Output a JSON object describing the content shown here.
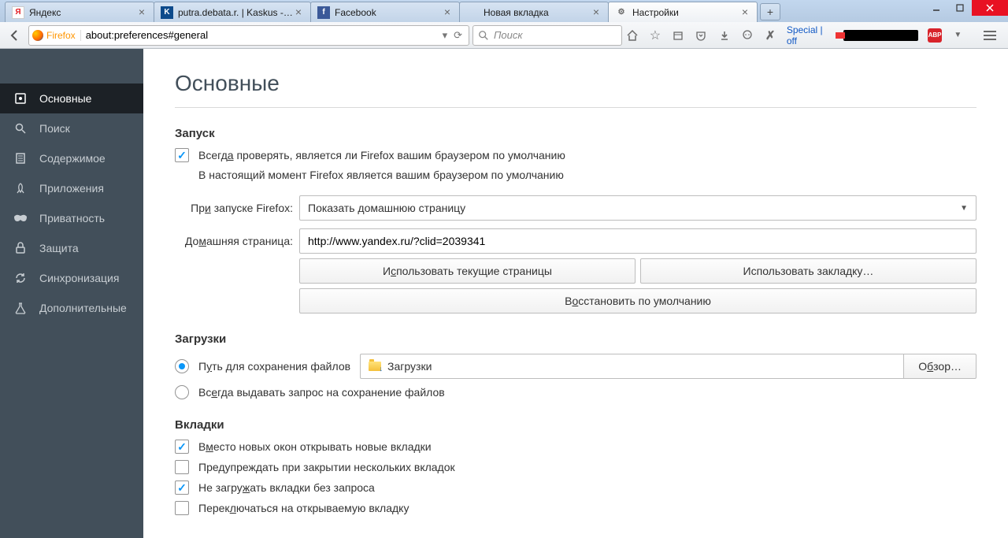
{
  "tabs": [
    {
      "label": "Яндекс"
    },
    {
      "label": "putra.debata.r. | Kaskus - ..."
    },
    {
      "label": "Facebook"
    },
    {
      "label": "Новая вкладка"
    },
    {
      "label": "Настройки"
    }
  ],
  "url": "about:preferences#general",
  "fx_label": "Firefox",
  "search_placeholder": "Поиск",
  "special_text": "Special | off",
  "abp": "ABP",
  "sidebar": [
    {
      "label": "Основные"
    },
    {
      "label": "Поиск"
    },
    {
      "label": "Содержимое"
    },
    {
      "label": "Приложения"
    },
    {
      "label": "Приватность"
    },
    {
      "label": "Защита"
    },
    {
      "label": "Синхронизация"
    },
    {
      "label": "Дополнительные"
    }
  ],
  "page_title": "Основные",
  "startup": {
    "heading": "Запуск",
    "check_default": "Всегда проверять, является ли Firefox вашим браузером по умолчанию",
    "status": "В настоящий момент Firefox является вашим браузером по умолчанию",
    "on_start_label": "При запуске Firefox:",
    "on_start_value": "Показать домашнюю страницу",
    "homepage_label": "Домашняя страница:",
    "homepage_value": "http://www.yandex.ru/?clid=2039341",
    "btn_use_current": "Использовать текущие страницы",
    "btn_use_bookmark": "Использовать закладку…",
    "btn_restore": "Восстановить по умолчанию"
  },
  "downloads": {
    "heading": "Загрузки",
    "save_to_label": "Путь для сохранения файлов",
    "path": "Загрузки",
    "browse": "Обзор…",
    "always_ask": "Всегда выдавать запрос на сохранение файлов"
  },
  "tabs_section": {
    "heading": "Вкладки",
    "open_in_tabs": "Вместо новых окон открывать новые вкладки",
    "warn_close": "Предупреждать при закрытии нескольких вкладок",
    "dont_load": "Не загружать вкладки без запроса",
    "switch_to": "Переключаться на открываемую вкладку"
  }
}
